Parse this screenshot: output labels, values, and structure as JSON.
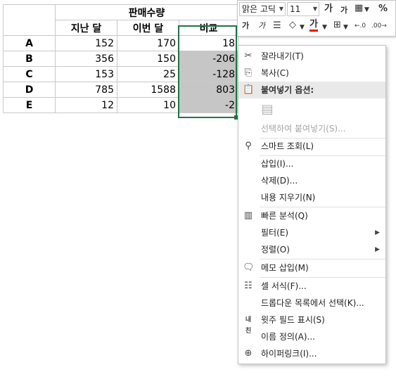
{
  "sheet": {
    "group_header": "판매수량",
    "columns": [
      "지난 달",
      "이번 달",
      "비교"
    ],
    "rows": [
      {
        "label": "A",
        "last": "152",
        "this": "170",
        "cmp": "18"
      },
      {
        "label": "B",
        "last": "356",
        "this": "150",
        "cmp": "-206"
      },
      {
        "label": "C",
        "last": "153",
        "this": "25",
        "cmp": "-128"
      },
      {
        "label": "D",
        "last": "785",
        "this": "1588",
        "cmp": "803"
      },
      {
        "label": "E",
        "last": "12",
        "this": "10",
        "cmp": "-2"
      }
    ]
  },
  "mini_toolbar": {
    "font_name": "맑은 고딕",
    "font_size": "11",
    "grow_font": "가",
    "shrink_font": "가",
    "percent": "%",
    "bold": "가",
    "italic": "가",
    "font_color_letter": "가",
    "font_color": "#ff0000",
    "comma": ",",
    "dec_left": "←.0 .00",
    "dec_right": ".00 →.0"
  },
  "menu": {
    "cut": "잘라내기(T)",
    "copy": "복사(C)",
    "paste_options": "붙여넣기 옵션:",
    "paste_special": "선택하여 붙여넣기(S)...",
    "smart_lookup": "스마트 조회(L)",
    "insert": "삽입(I)...",
    "delete": "삭제(D)...",
    "clear_contents": "내용 지우기(N)",
    "quick_analysis": "빠른 분석(Q)",
    "filter": "필터(E)",
    "sort": "정렬(O)",
    "insert_comment": "메모 삽입(M)",
    "format_cells": "셀 서식(F)...",
    "pick_from_list": "드롭다운 목록에서 선택(K)...",
    "phonetic": "윗주 필드 표시(S)",
    "define_name": "이름 정의(A)...",
    "hyperlink": "하이퍼링크(I)..."
  },
  "icons": {
    "cut": "scissors-icon",
    "copy": "copy-icon",
    "paste": "clipboard-icon",
    "smart_lookup": "search-icon",
    "quick_analysis": "quick-analysis-icon",
    "comment": "comment-icon",
    "format": "format-cells-icon",
    "phonetic": "phonetic-icon",
    "hyperlink": "link-icon"
  },
  "colors": {
    "selection_border": "#217346",
    "selected_fill": "#c6c6c6",
    "menu_header_bg": "#e9e9e9",
    "disabled_text": "#a6a6a6"
  }
}
